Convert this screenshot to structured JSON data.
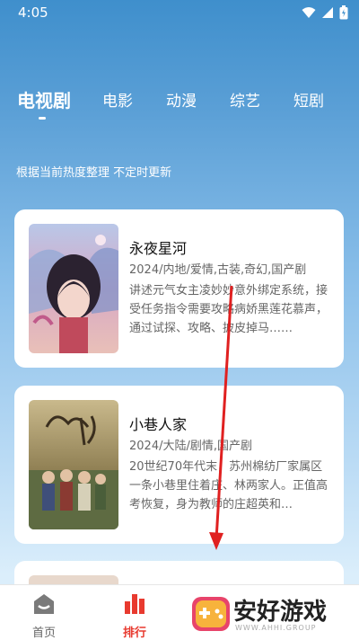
{
  "status_bar": {
    "time": "4:05"
  },
  "tabs": [
    {
      "label": "电视剧",
      "active": true
    },
    {
      "label": "电影",
      "active": false
    },
    {
      "label": "动漫",
      "active": false
    },
    {
      "label": "综艺",
      "active": false
    },
    {
      "label": "短剧",
      "active": false
    }
  ],
  "subtitle": "根据当前热度整理 不定时更新",
  "items": [
    {
      "title": "永夜星河",
      "meta": "2024/内地/爱情,古装,奇幻,国产剧",
      "description": "讲述元气女主凌妙妙意外绑定系统，接受任务指令需要攻略病娇黑莲花慕声，通过试探、攻略、披皮掉马……"
    },
    {
      "title": "小巷人家",
      "meta": "2024/大陆/剧情,国产剧",
      "description": "20世纪70年代末，苏州棉纺厂家属区一条小巷里住着庄、林两家人。正值高考恢复，身为教师的庄超英和…"
    }
  ],
  "bottom_nav": [
    {
      "label": "首页",
      "icon": "home-icon",
      "active": false
    },
    {
      "label": "排行",
      "icon": "ranking-icon",
      "active": true
    }
  ],
  "watermark": {
    "text": "安好游戏",
    "sub": "WWW.AHHI.GROUP"
  },
  "colors": {
    "accent": "#e83a2f",
    "background_top": "#3f8fcc",
    "background_bottom": "#dbeefb"
  }
}
